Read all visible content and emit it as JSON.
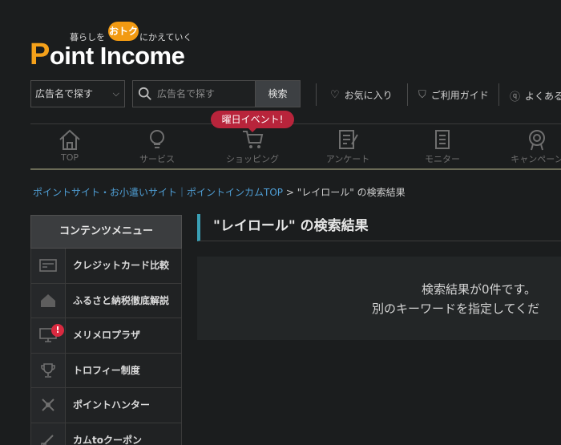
{
  "logo": {
    "tagline_left": "暮らしを",
    "tagline_bubble": "おトク",
    "tagline_right": "にかえていく",
    "word_p": "P",
    "word_rest": "oint Income",
    "brand_color": "#f5a11a"
  },
  "search": {
    "category_value": "広告名で探す",
    "placeholder": "広告名で探す",
    "button_label": "検索"
  },
  "header_links": {
    "favorites": "お気に入り",
    "guide": "ご利用ガイド",
    "faq": "よくある"
  },
  "event_badge": "曜日イベント!",
  "nav": [
    {
      "label": "TOP",
      "icon": "home-icon"
    },
    {
      "label": "サービス",
      "icon": "bulb-icon"
    },
    {
      "label": "ショッピング",
      "icon": "cart-icon"
    },
    {
      "label": "アンケート",
      "icon": "survey-icon"
    },
    {
      "label": "モニター",
      "icon": "document-icon"
    },
    {
      "label": "キャンペーン",
      "icon": "medal-icon"
    }
  ],
  "breadcrumb": {
    "link1": "ポイントサイト・お小遣いサイト｜ポイントインカムTOP",
    "separator": ">",
    "current": "\"レイロール\" の検索結果"
  },
  "sidebar": {
    "heading": "コンテンツメニュー",
    "items": [
      {
        "label": "クレジットカード比較",
        "icon": "credit-card-icon"
      },
      {
        "label": "ふるさと納税徹底解説",
        "icon": "house-icon"
      },
      {
        "label": "メリメロプラザ",
        "icon": "monitor-icon",
        "alert": "!"
      },
      {
        "label": "トロフィー制度",
        "icon": "trophy-icon"
      },
      {
        "label": "ポイントハンター",
        "icon": "hunter-icon"
      },
      {
        "label": "カムtoクーポン",
        "icon": "coupon-icon"
      }
    ]
  },
  "main": {
    "title": "\"レイロール\" の検索結果",
    "result_line1": "検索結果が0件です。",
    "result_line2": "別のキーワードを指定してくだ"
  }
}
